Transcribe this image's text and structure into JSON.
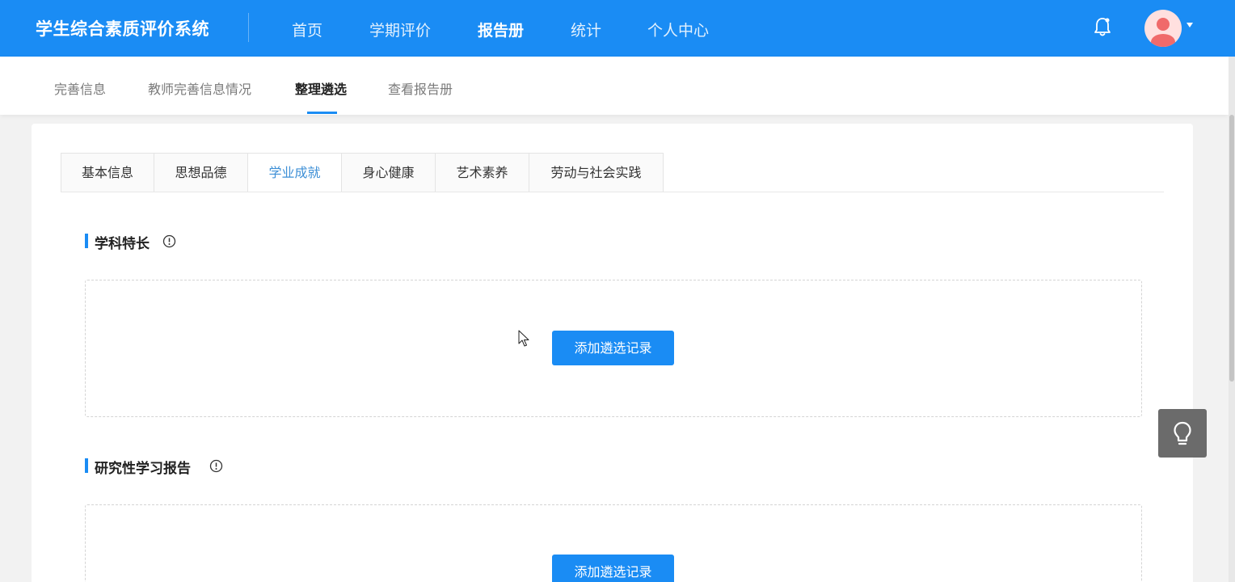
{
  "header": {
    "app_title": "学生综合素质评价系统",
    "nav": [
      {
        "label": "首页",
        "active": false
      },
      {
        "label": "学期评价",
        "active": false
      },
      {
        "label": "报告册",
        "active": true
      },
      {
        "label": "统计",
        "active": false
      },
      {
        "label": "个人中心",
        "active": false
      }
    ],
    "bell_icon": "bell-icon",
    "avatar_icon": "user-avatar",
    "dropdown_icon": "caret-down-icon"
  },
  "subnav": {
    "items": [
      {
        "label": "完善信息",
        "active": false
      },
      {
        "label": "教师完善信息情况",
        "active": false
      },
      {
        "label": "整理遴选",
        "active": true
      },
      {
        "label": "查看报告册",
        "active": false
      }
    ]
  },
  "tabs": [
    {
      "label": "基本信息",
      "active": false
    },
    {
      "label": "思想品德",
      "active": false
    },
    {
      "label": "学业成就",
      "active": true
    },
    {
      "label": "身心健康",
      "active": false
    },
    {
      "label": "艺术素养",
      "active": false
    },
    {
      "label": "劳动与社会实践",
      "active": false
    }
  ],
  "sections": [
    {
      "title": "学科特长",
      "info_icon": "info-circle-icon",
      "button_label": "添加遴选记录"
    },
    {
      "title": "研究性学习报告",
      "info_icon": "info-circle-icon",
      "button_label": "添加遴选记录"
    }
  ],
  "floating_button": {
    "icon": "lightbulb-icon"
  },
  "colors": {
    "primary": "#1a8cf4",
    "active_tab_text": "#3d8fd6",
    "float_button_bg": "#6b6b6b"
  }
}
